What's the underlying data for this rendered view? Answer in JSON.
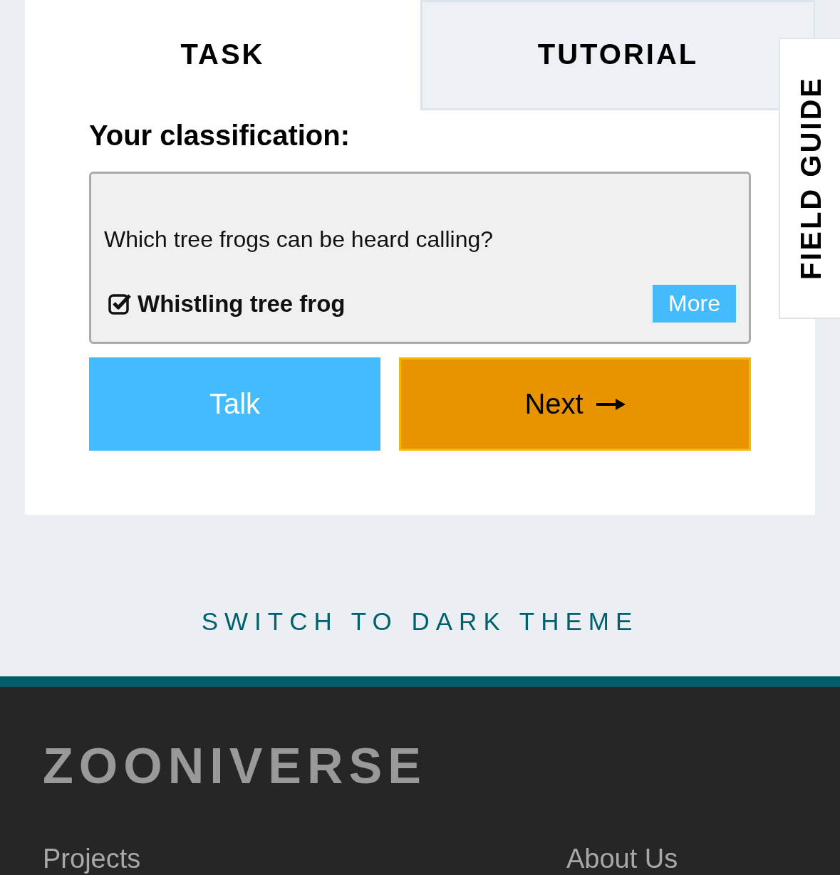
{
  "tabs": [
    {
      "label": "TASK",
      "selected": true
    },
    {
      "label": "TUTORIAL",
      "selected": false
    }
  ],
  "field_guide": {
    "label": "FIELD GUIDE"
  },
  "task": {
    "heading": "Your classification:",
    "question": "Which tree frogs can be heard calling?",
    "answers": [
      {
        "label": "Whistling tree frog",
        "checked": true,
        "more": "More"
      }
    ]
  },
  "buttons": [
    {
      "kind": "talk",
      "label": "Talk"
    },
    {
      "kind": "next",
      "label": "Next"
    }
  ],
  "theme_toggle": "SWITCH TO DARK THEME",
  "footer": {
    "logo": "ZOONIVERSE",
    "links": [
      "Projects",
      "About Us"
    ]
  }
}
